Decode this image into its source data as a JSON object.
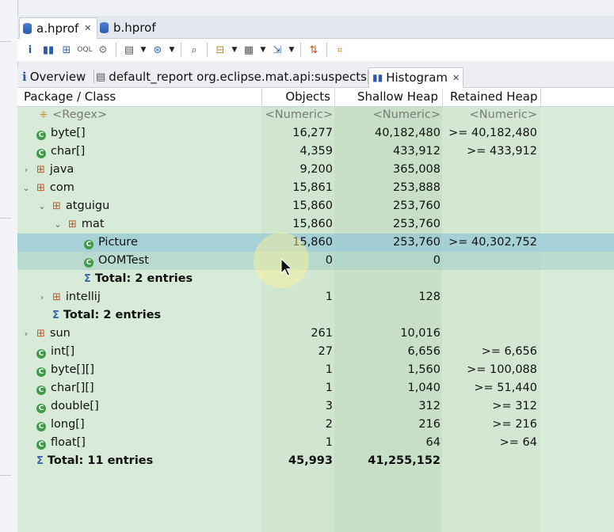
{
  "editor_tabs": [
    {
      "label": "a.hprof",
      "active": true
    },
    {
      "label": "b.hprof",
      "active": false
    }
  ],
  "view_tabs": [
    {
      "label": "Overview",
      "icon": "info-icon"
    },
    {
      "label": "default_report  org.eclipse.mat.api:suspects",
      "icon": "report-icon"
    },
    {
      "label": "Histogram",
      "icon": "histogram-icon",
      "active": true
    }
  ],
  "columns": {
    "class": "Package / Class",
    "objects": "Objects",
    "shallow": "Shallow Heap",
    "retained": "Retained Heap"
  },
  "filter_row": {
    "class": "<Regex>",
    "objects": "<Numeric>",
    "shallow": "<Numeric>",
    "retained": "<Numeric>"
  },
  "rows": [
    {
      "kind": "class",
      "indent": 0,
      "name": "byte[]",
      "objects": "16,277",
      "shallow": "40,182,480",
      "retained": ">= 40,182,480"
    },
    {
      "kind": "class",
      "indent": 0,
      "name": "char[]",
      "objects": "4,359",
      "shallow": "433,912",
      "retained": ">= 433,912"
    },
    {
      "kind": "package",
      "indent": 0,
      "toggle": "collapsed",
      "name": "java",
      "objects": "9,200",
      "shallow": "365,008",
      "retained": ""
    },
    {
      "kind": "package",
      "indent": 0,
      "toggle": "expanded",
      "name": "com",
      "objects": "15,861",
      "shallow": "253,888",
      "retained": ""
    },
    {
      "kind": "package",
      "indent": 1,
      "toggle": "expanded",
      "name": "atguigu",
      "objects": "15,860",
      "shallow": "253,760",
      "retained": ""
    },
    {
      "kind": "package",
      "indent": 2,
      "toggle": "expanded",
      "name": "mat",
      "objects": "15,860",
      "shallow": "253,760",
      "retained": ""
    },
    {
      "kind": "class",
      "indent": 3,
      "name": "Picture",
      "objects": "15,860",
      "shallow": "253,760",
      "retained": ">= 40,302,752",
      "selected": true
    },
    {
      "kind": "class",
      "indent": 3,
      "name": "OOMTest",
      "objects": "0",
      "shallow": "0",
      "retained": "",
      "hl": true
    },
    {
      "kind": "total",
      "indent": 3,
      "name": "Total: 2 entries",
      "objects": "",
      "shallow": "",
      "retained": ""
    },
    {
      "kind": "package",
      "indent": 1,
      "toggle": "collapsed",
      "name": "intellij",
      "objects": "1",
      "shallow": "128",
      "retained": ""
    },
    {
      "kind": "total",
      "indent": 1,
      "name": "Total: 2 entries",
      "objects": "",
      "shallow": "",
      "retained": ""
    },
    {
      "kind": "package",
      "indent": 0,
      "toggle": "collapsed",
      "name": "sun",
      "objects": "261",
      "shallow": "10,016",
      "retained": ""
    },
    {
      "kind": "class",
      "indent": 0,
      "name": "int[]",
      "objects": "27",
      "shallow": "6,656",
      "retained": ">= 6,656"
    },
    {
      "kind": "class",
      "indent": 0,
      "name": "byte[][]",
      "objects": "1",
      "shallow": "1,560",
      "retained": ">= 100,088"
    },
    {
      "kind": "class",
      "indent": 0,
      "name": "char[][]",
      "objects": "1",
      "shallow": "1,040",
      "retained": ">= 51,440"
    },
    {
      "kind": "class",
      "indent": 0,
      "name": "double[]",
      "objects": "3",
      "shallow": "312",
      "retained": ">= 312"
    },
    {
      "kind": "class",
      "indent": 0,
      "name": "long[]",
      "objects": "2",
      "shallow": "216",
      "retained": ">= 216"
    },
    {
      "kind": "class",
      "indent": 0,
      "name": "float[]",
      "objects": "1",
      "shallow": "64",
      "retained": ">= 64"
    },
    {
      "kind": "total",
      "indent": 0,
      "name": "Total: 11 entries",
      "objects": "45,993",
      "shallow": "41,255,152",
      "retained": "",
      "bold_values": true
    }
  ],
  "colors": {
    "table_bg": "#d6e9d6",
    "selected_row": "#9cc9d6",
    "class_icon": "#3e9b47",
    "package_icon": "#c0561f"
  }
}
